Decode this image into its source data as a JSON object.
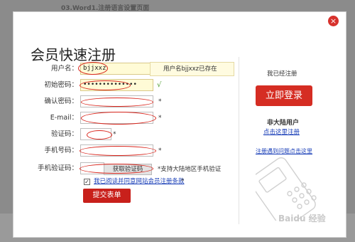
{
  "background": {
    "snippet": "03.Word1.注册语言设置页面"
  },
  "modal": {
    "title": "会员快速注册",
    "close_glyph": "×"
  },
  "form": {
    "username": {
      "label": "用户名：",
      "value": "bjjxxz"
    },
    "init_password": {
      "label": "初始密码：",
      "value": "••••••••••••••",
      "check": "√"
    },
    "confirm_password": {
      "label": "确认密码：",
      "value": "",
      "star": "*"
    },
    "email": {
      "label": "E-mail：",
      "value": "",
      "star": "*"
    },
    "captcha": {
      "label": "验证码：",
      "value": "",
      "star": "*"
    },
    "mobile": {
      "label": "手机号码：",
      "value": "",
      "star": "*"
    },
    "mobile_code": {
      "label": "手机验证码：",
      "value": "",
      "button": "获取验证码",
      "note": "*支持大陆地区手机验证"
    },
    "agreement": {
      "checked": "✓",
      "text": "我已阅读并同意网站会员注册条款",
      "star": "*"
    },
    "submit": "提交表单",
    "username_tip": "用户名bjjxxz已存在"
  },
  "sidebar": {
    "have_account": "我已经注册",
    "login_button": "立即登录",
    "non_mainland": "非大陆用户",
    "register_link": "点击这里注册",
    "problem_link": "注册遇到问题点击这里"
  },
  "watermark": "Baidu 经验",
  "colors": {
    "accent_red": "#d52d23",
    "link_blue": "#1a3fb8",
    "annotation_red": "#d9261d"
  }
}
